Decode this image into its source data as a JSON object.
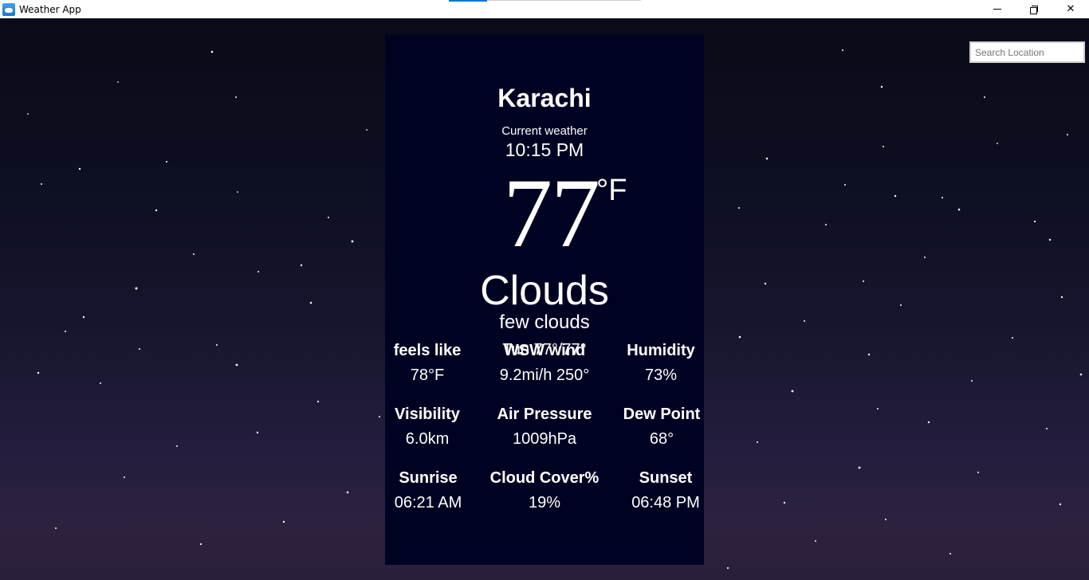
{
  "window": {
    "title": "Weather App",
    "controls": {
      "minimize": "minimize",
      "restore": "restore",
      "close": "✕"
    }
  },
  "search": {
    "placeholder": "Search Location",
    "value": ""
  },
  "weather": {
    "city": "Karachi",
    "current_label": "Current weather",
    "time": "10:15 PM",
    "temperature": "77",
    "unit": "°F",
    "condition": "Clouds",
    "description": "few clouds",
    "day_range": "Tue  77°/77°"
  },
  "stats": [
    {
      "label": "feels like",
      "value": "78°F"
    },
    {
      "label": "WSW wind",
      "value": "9.2mi/h 250°"
    },
    {
      "label": "Humidity",
      "value": "73%"
    },
    {
      "label": "Visibility",
      "value": "6.0km"
    },
    {
      "label": "Air Pressure",
      "value": "1009hPa"
    },
    {
      "label": "Dew Point",
      "value": "68°"
    },
    {
      "label": "Sunrise",
      "value": "06:21 AM"
    },
    {
      "label": "Cloud Cover%",
      "value": "19%"
    },
    {
      "label": "Sunset",
      "value": "06:48 PM"
    }
  ],
  "colors": {
    "card_background": "#000222",
    "text": "#ffffff",
    "titlebar": "#ffffff",
    "accent": "#0078d7"
  }
}
